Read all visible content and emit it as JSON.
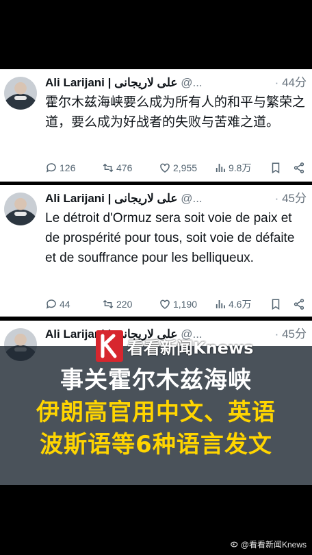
{
  "tweets": [
    {
      "name": "Ali Larijani",
      "sep": " | ",
      "name_fa": "علی لاریجانی",
      "handle": "@...",
      "dot": "·",
      "time": "44分",
      "text": "霍尔木兹海峡要么成为所有人的和平与繁荣之道，要么成为好战者的失败与苦难之道。",
      "replies": "126",
      "retweets": "476",
      "likes": "2,955",
      "views": "9.8万"
    },
    {
      "name": "Ali Larijani",
      "sep": " | ",
      "name_fa": "علی لاریجانی",
      "handle": "@...",
      "dot": "·",
      "time": "45分",
      "text": "Le détroit d'Ormuz sera soit voie de paix et de prospérité pour tous, soit voie de défaite et de souffrance pour les belliqueux.",
      "replies": "44",
      "retweets": "220",
      "likes": "1,190",
      "views": "4.6万"
    },
    {
      "name": "Ali Larijani",
      "sep": " | ",
      "name_fa": "علی لاریجانی",
      "handle": "@...",
      "dot": "·",
      "time": "45分"
    }
  ],
  "banner": {
    "brand": "看看新闻Knews",
    "line1": "事关霍尔木兹海峡",
    "line2": "伊朗高官用中文、英语",
    "line3": "波斯语等6种语言发文"
  },
  "watermark": "@看看新闻Knews",
  "colors": {
    "headline_white": "#ffffff",
    "headline_yellow": "#ffd500",
    "banner_bg": "#222c36",
    "brand_red": "#d7262e"
  }
}
